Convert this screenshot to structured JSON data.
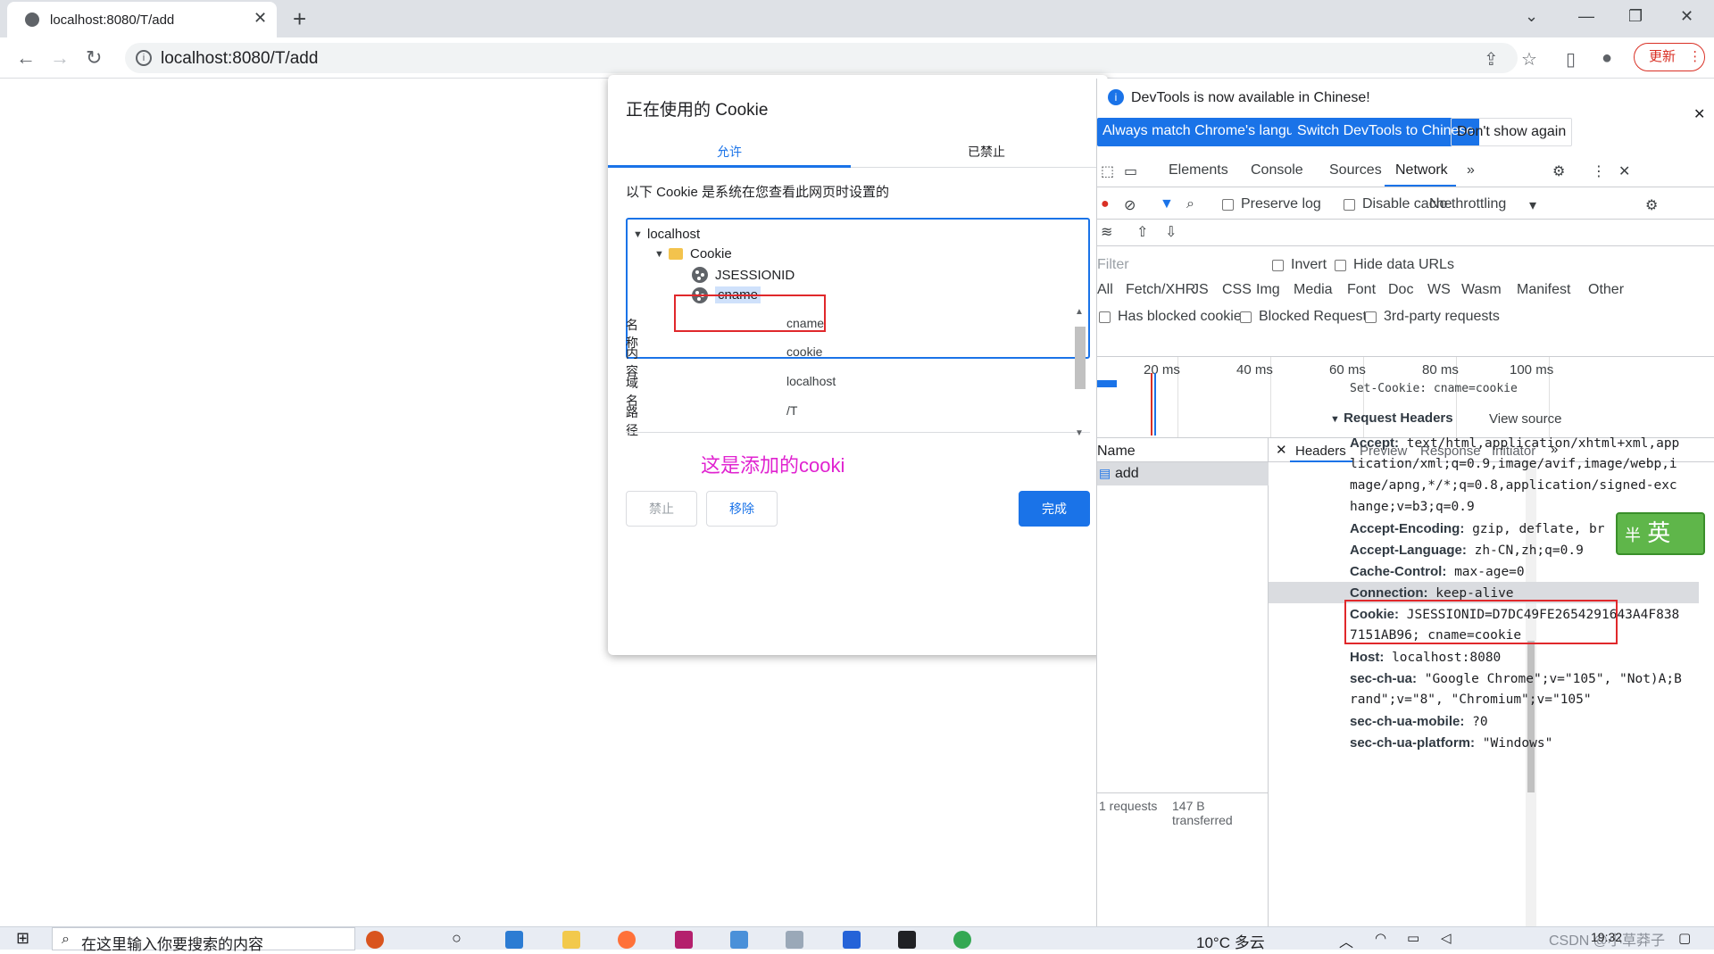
{
  "browser": {
    "tab_title": "localhost:8080/T/add",
    "url": "localhost:8080/T/add",
    "update_label": "更新"
  },
  "dialog": {
    "title": "正在使用的 Cookie",
    "tabs": [
      "允许",
      "已禁止"
    ],
    "description": "以下 Cookie 是系统在您查看此网页时设置的",
    "tree": {
      "host": "localhost",
      "folder": "Cookie",
      "items": [
        "JSESSIONID",
        "cname"
      ],
      "selected": "cname"
    },
    "details": [
      {
        "key": "名称",
        "value": "cname"
      },
      {
        "key": "内容",
        "value": "cookie"
      },
      {
        "key": "域名",
        "value": "localhost"
      },
      {
        "key": "路径",
        "value": "/T"
      }
    ],
    "annotation": "这是添加的cooki",
    "buttons": {
      "block": "禁止",
      "remove": "移除",
      "done": "完成"
    }
  },
  "devtools": {
    "notice": {
      "message": "DevTools is now available in Chinese!",
      "btn_match": "Always match Chrome's language",
      "btn_switch": "Switch DevTools to Chinese",
      "btn_dismiss": "Don't show again"
    },
    "tabs": [
      "Elements",
      "Console",
      "Sources",
      "Network"
    ],
    "active_tab": "Network",
    "toolbar": {
      "preserve_log": "Preserve log",
      "disable_cache": "Disable cache",
      "throttling": "No throttling"
    },
    "filter": {
      "placeholder": "Filter",
      "invert": "Invert",
      "hide_data_urls": "Hide data URLs",
      "types": [
        "All",
        "Fetch/XHR",
        "JS",
        "CSS",
        "Img",
        "Media",
        "Font",
        "Doc",
        "WS",
        "Wasm",
        "Manifest",
        "Other"
      ],
      "has_blocked": "Has blocked cookies",
      "blocked_requests": "Blocked Requests",
      "third_party": "3rd-party requests"
    },
    "timeline_ticks": [
      "20 ms",
      "40 ms",
      "60 ms",
      "80 ms",
      "100 ms"
    ],
    "request_list": {
      "header": "Name",
      "rows": [
        "add"
      ],
      "status_requests": "1 requests",
      "status_transferred": "147 B transferred"
    },
    "detail_tabs": [
      "Headers",
      "Preview",
      "Response",
      "Initiator"
    ],
    "set_cookie_line": "Set-Cookie: cname=cookie",
    "request_headers_title": "Request Headers",
    "view_source": "View source",
    "headers": [
      {
        "name": "Accept:",
        "lines": [
          "text/html,application/xhtml+xml,app",
          "lication/xml;q=0.9,image/avif,image/webp,i",
          "mage/apng,*/*;q=0.8,application/signed-exc",
          "hange;v=b3;q=0.9"
        ]
      },
      {
        "name": "Accept-Encoding:",
        "lines": [
          "gzip, deflate, br"
        ]
      },
      {
        "name": "Accept-Language:",
        "lines": [
          "zh-CN,zh;q=0.9"
        ]
      },
      {
        "name": "Cache-Control:",
        "lines": [
          "max-age=0"
        ]
      },
      {
        "name": "Connection:",
        "lines": [
          "keep-alive"
        ]
      },
      {
        "name": "Cookie:",
        "lines": [
          "JSESSIONID=D7DC49FE2654291643A4F838",
          "7151AB96; cname=cookie"
        ]
      },
      {
        "name": "Host:",
        "lines": [
          "localhost:8080"
        ]
      },
      {
        "name": "sec-ch-ua:",
        "lines": [
          "\"Google Chrome\";v=\"105\", \"Not)A;B",
          "rand\";v=\"8\", \"Chromium\";v=\"105\""
        ]
      },
      {
        "name": "sec-ch-ua-mobile:",
        "lines": [
          "?0"
        ]
      },
      {
        "name": "sec-ch-ua-platform:",
        "lines": [
          "\"Windows\""
        ]
      }
    ],
    "ime_label": "英"
  },
  "taskbar": {
    "search_placeholder": "在这里输入你要搜索的内容",
    "weather": "10°C 多云",
    "time": "19:32",
    "watermark": "CSDN @小草莽子"
  }
}
